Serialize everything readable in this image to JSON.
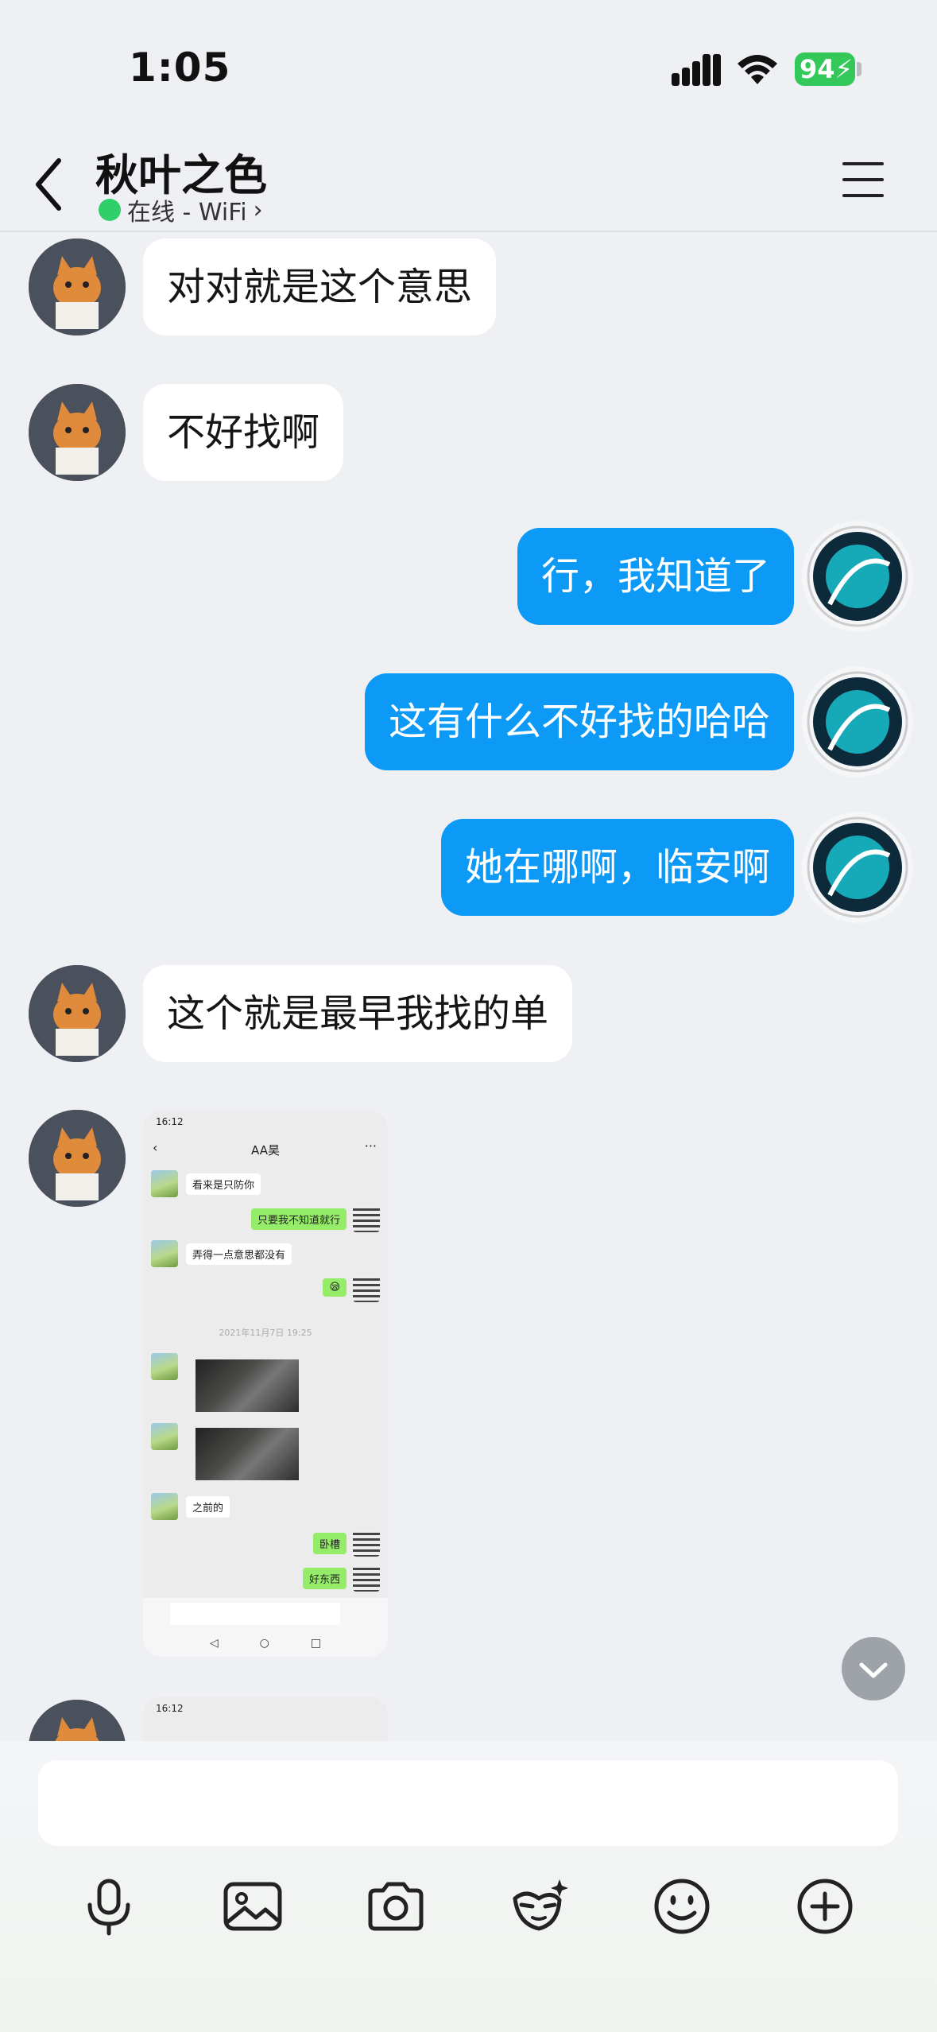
{
  "status_bar": {
    "time": "1:05",
    "battery": "94"
  },
  "header": {
    "name": "秋叶之色",
    "presence": "在线 - WiFi",
    "presence_color": "#2fd06a"
  },
  "colors": {
    "outgoing_bubble": "#0d99f6",
    "incoming_bubble": "#ffffff",
    "background": "#eff0f4"
  },
  "messages": [
    {
      "side": "in",
      "text": "对对就是这个意思"
    },
    {
      "side": "in",
      "text": "不好找啊"
    },
    {
      "side": "out",
      "text": "行，我知道了"
    },
    {
      "side": "out",
      "text": "这有什么不好找的哈哈"
    },
    {
      "side": "out",
      "text": "她在哪啊，临安啊"
    },
    {
      "side": "in",
      "text": "这个就是最早我找的单"
    },
    {
      "side": "in",
      "type": "image",
      "image": "screenshot_1"
    },
    {
      "side": "in",
      "type": "image",
      "image": "screenshot_2"
    }
  ],
  "screenshot_1": {
    "status_time": "16:12",
    "title": "AA昊",
    "messages": [
      {
        "side": "in",
        "text": "看来是只防你"
      },
      {
        "side": "out",
        "text": "只要我不知道就行"
      },
      {
        "side": "in",
        "text": "弄得一点意思都没有"
      },
      {
        "side": "out",
        "text": "😪"
      },
      {
        "timestamp": "2021年11月7日 19:25"
      },
      {
        "side": "in",
        "type": "photo"
      },
      {
        "side": "in",
        "type": "photo"
      },
      {
        "side": "in",
        "text": "之前的"
      },
      {
        "side": "out",
        "text": "卧槽"
      },
      {
        "side": "out",
        "text": "好东西"
      }
    ],
    "nav": [
      "◁",
      "○",
      "□"
    ]
  },
  "screenshot_2": {
    "status_time": "16:12"
  },
  "input": {
    "placeholder": ""
  },
  "toolbar": [
    "microphone-icon",
    "image-icon",
    "camera-icon",
    "sticker-icon",
    "emoji-icon",
    "plus-icon"
  ]
}
